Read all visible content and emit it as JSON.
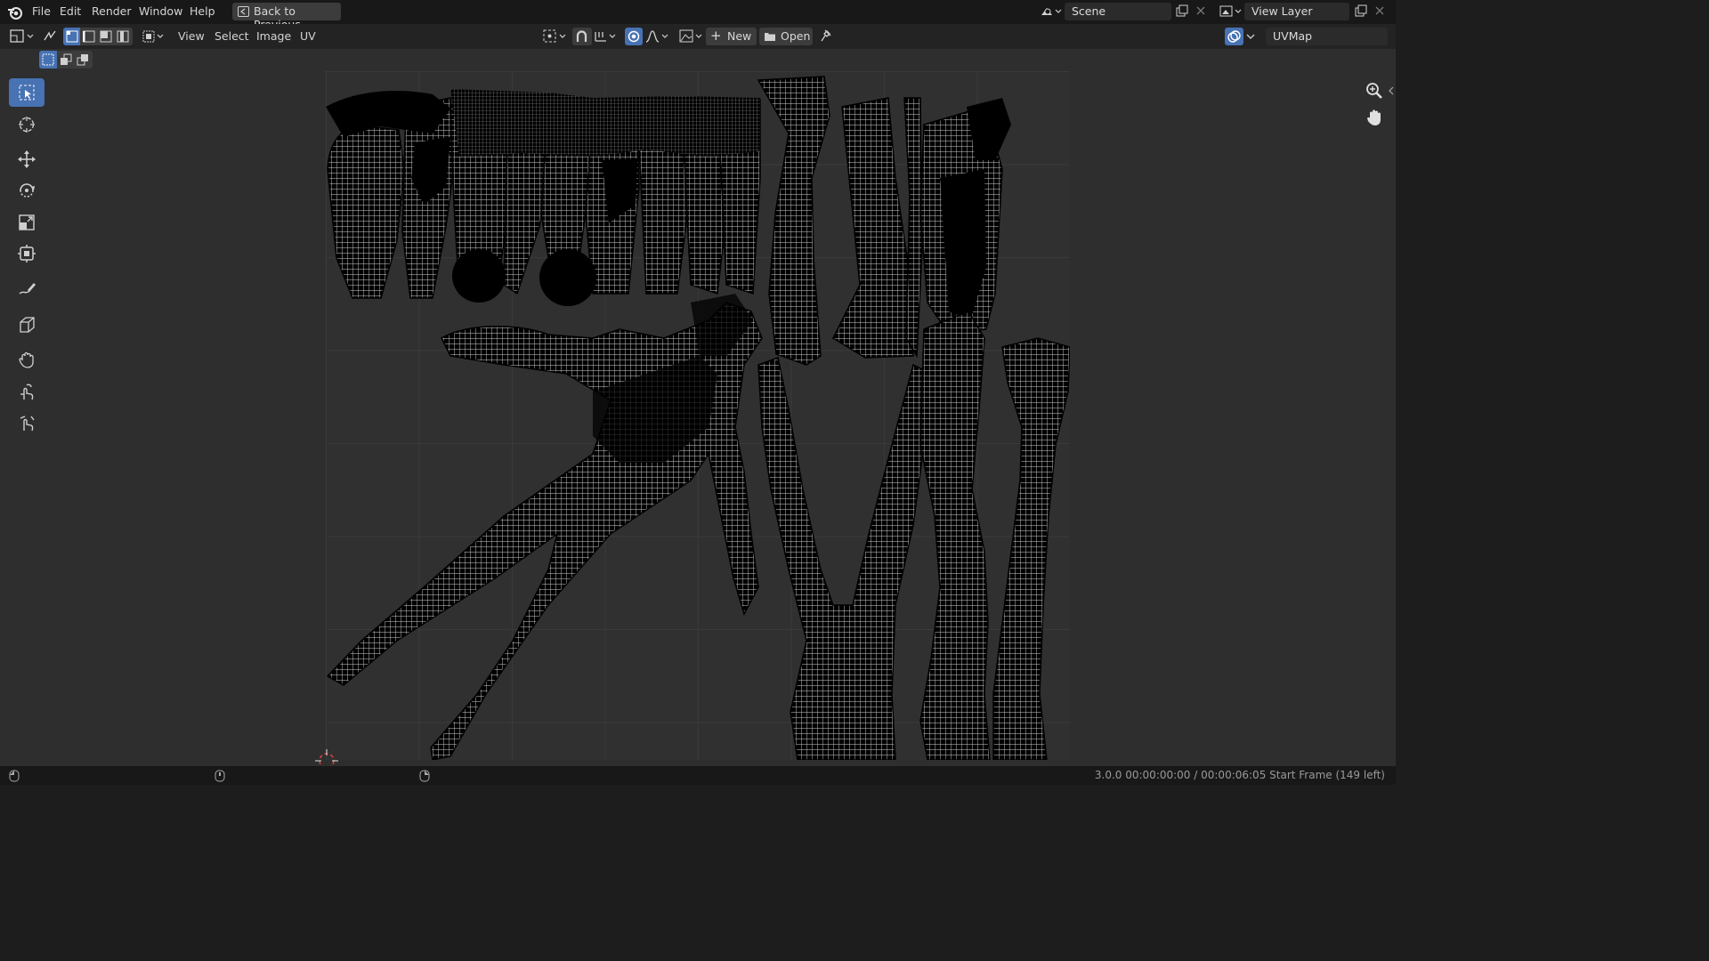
{
  "topbar": {
    "menu": [
      "File",
      "Edit",
      "Render",
      "Window",
      "Help"
    ],
    "back_button": "Back to Previous",
    "scene_name": "Scene",
    "view_layer_name": "View Layer"
  },
  "header": {
    "menus": [
      "View",
      "Select",
      "Image",
      "UV"
    ],
    "new_button": "New",
    "open_button": "Open",
    "uvmap_name": "UVMap"
  },
  "toolbar": {
    "tools": [
      "select-box-icon",
      "cursor-icon",
      "move-icon",
      "rotate-icon",
      "scale-icon",
      "transform-icon",
      "annotate-icon",
      "rip-region-icon",
      "grab-icon",
      "relax-icon",
      "pinch-icon"
    ],
    "active_tool": "select-box-icon"
  },
  "status": {
    "text": "3.0.0  00:00:00:00 / 00:00:06:05  Start Frame (149 left)"
  },
  "colors": {
    "accent": "#4772b3",
    "background": "#2e2e2e",
    "uv_wire": "#ffffff",
    "uv_fill": "#000000"
  }
}
